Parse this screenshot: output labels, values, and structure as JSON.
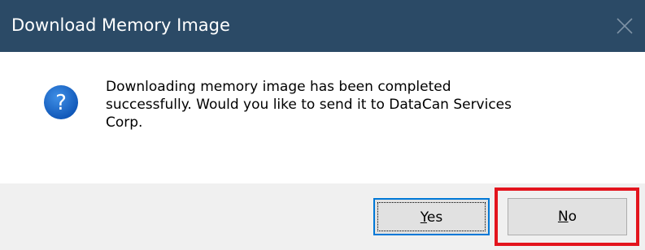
{
  "window": {
    "title": "Download Memory Image",
    "close_icon": "close-icon",
    "titlebar_color": "#2b4a66"
  },
  "dialog": {
    "icon": "question-icon",
    "icon_color": "#1c6fd0",
    "message": "Downloading memory image has been completed\nsuccessfully.  Would you like to send it to DataCan Services\nCorp."
  },
  "buttons": {
    "yes": {
      "label_mnemonic": "Y",
      "label_rest": "es",
      "focused": true
    },
    "no": {
      "label_mnemonic": "N",
      "label_rest": "o",
      "highlighted": true
    }
  },
  "highlight_color": "#e3141d"
}
